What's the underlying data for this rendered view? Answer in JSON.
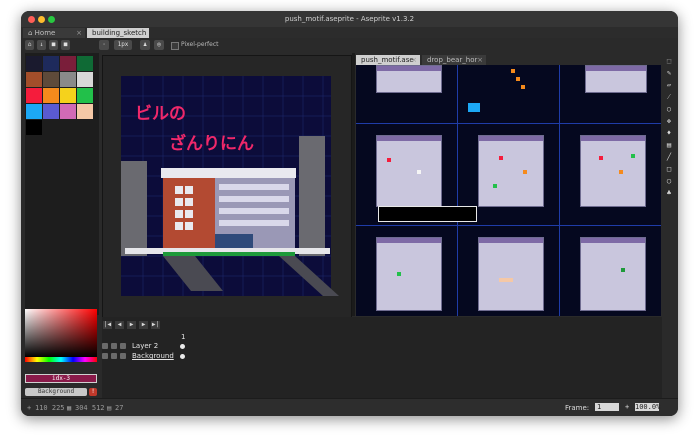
{
  "window": {
    "title": "push_motif.aseprite - Aseprite v1.3.2"
  },
  "tabs": [
    {
      "label": "Home"
    },
    {
      "label": "building_sketch"
    }
  ],
  "toolbar": {
    "brush_size": "1px",
    "pixel_perfect_label": "Pixel-perfect"
  },
  "palette": {
    "colors": [
      "#1a1a2e",
      "#1e2a5c",
      "#7a1e3a",
      "#0f6a35",
      "#a34e2a",
      "#5e4a3a",
      "#8a8a8a",
      "#d8d8d8",
      "#f51c3c",
      "#f58a1c",
      "#f5d21c",
      "#22c04a",
      "#1ca8f5",
      "#5a5ad2",
      "#d26ab6",
      "#f5c8a6",
      "#000000"
    ]
  },
  "color_bar": {
    "fg_label": "idx-3",
    "bg_label": "Background",
    "warning": "!"
  },
  "canvas_left": {
    "text_line1": "ビルの",
    "text_line2": "ざんりにん"
  },
  "doc_tabs": [
    {
      "label": "push_motif.ase"
    },
    {
      "label": "drop_bear_hor"
    }
  ],
  "timeline": {
    "frame_number": "1",
    "layers": [
      {
        "name": "Layer 2"
      },
      {
        "name": "Background"
      }
    ]
  },
  "status": {
    "coords": "110 225",
    "size": "304 512",
    "frames": "27",
    "frame_label": "Frame:",
    "frame_value": "1",
    "zoom": "100.0%"
  },
  "colors": {
    "accent": "#8a1a4a",
    "text_pink": "#f0286a",
    "grid": "#1f3ca8"
  }
}
